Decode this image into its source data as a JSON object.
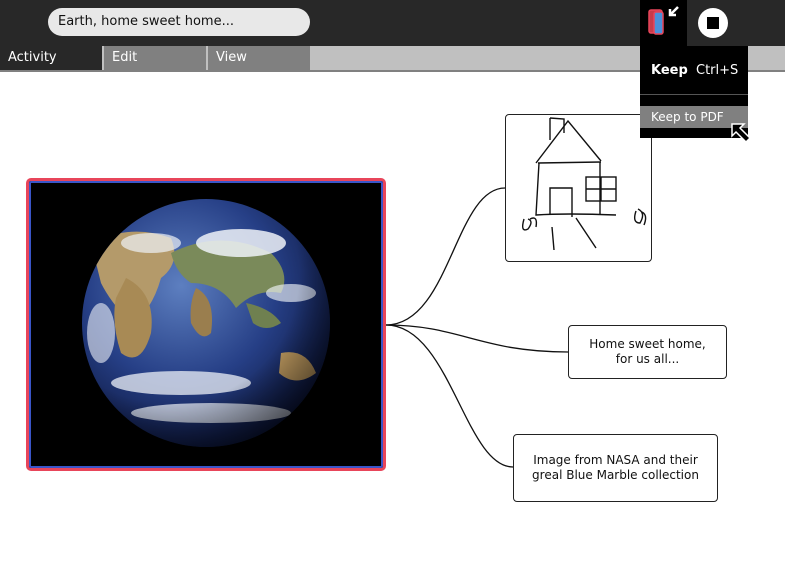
{
  "toolbar": {
    "title": "Earth, home sweet home...",
    "keep_icon": "journal-keep-icon",
    "stop_icon": "stop-icon"
  },
  "tabs": [
    {
      "label": "Activity",
      "active": true
    },
    {
      "label": "Edit",
      "active": false
    },
    {
      "label": "View",
      "active": false
    }
  ],
  "keep_palette": {
    "keep_label": "Keep",
    "keep_shortcut": "Ctrl+S",
    "pdf_label": "Keep to PDF"
  },
  "canvas": {
    "image_node": "earth-image",
    "drawing_node": "house-drawing",
    "notes": [
      {
        "text": "Home sweet home,\nfor us all..."
      },
      {
        "text": "Image from NASA and their\ngreal Blue Marble collection"
      }
    ]
  },
  "colors": {
    "toolbar": "#282828",
    "selection_border": "#e8455a",
    "tab_inactive": "#808080"
  }
}
